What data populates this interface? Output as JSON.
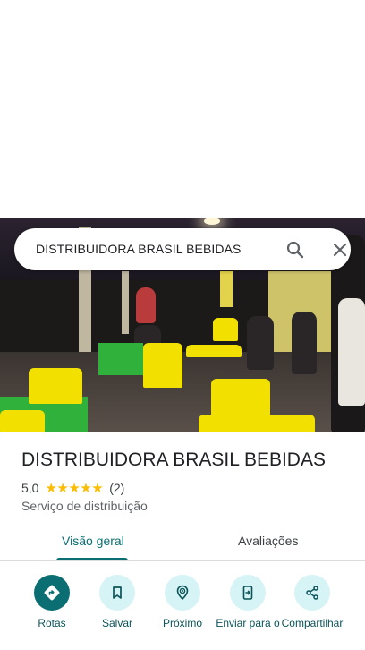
{
  "search": {
    "query": "DISTRIBUIDORA BRASIL BEBIDAS"
  },
  "place": {
    "name": "DISTRIBUIDORA BRASIL BEBIDAS",
    "rating": "5,0",
    "stars": "★★★★★",
    "review_count": "(2)",
    "category": "Serviço de distribuição"
  },
  "tabs": [
    {
      "label": "Visão geral",
      "active": true
    },
    {
      "label": "Avaliações",
      "active": false
    }
  ],
  "actions": [
    {
      "label": "Rotas",
      "icon": "directions-icon"
    },
    {
      "label": "Salvar",
      "icon": "bookmark-icon"
    },
    {
      "label": "Próximo",
      "icon": "nearby-icon"
    },
    {
      "label": "Enviar para o",
      "icon": "send-to-phone-icon"
    },
    {
      "label": "Compartilhar",
      "icon": "share-icon"
    }
  ],
  "colors": {
    "accent": "#0b6e73",
    "action_bg": "#d6f3f5",
    "star": "#fbbc04"
  }
}
